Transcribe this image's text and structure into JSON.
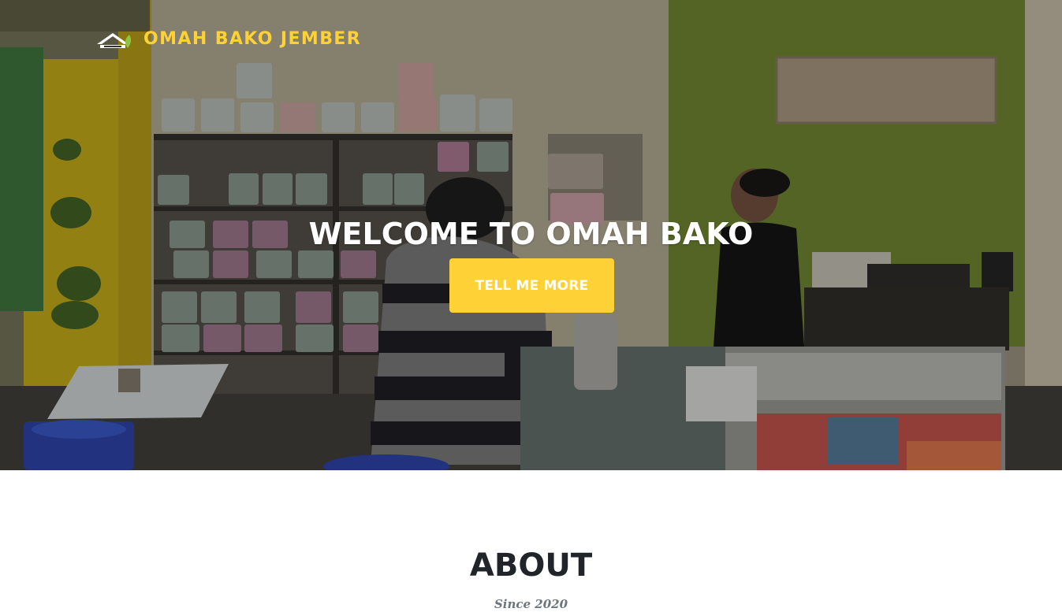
{
  "navbar": {
    "brand_name": "OMAH BAKO JEMBER",
    "logo_icon": "house-leaf-logo-icon"
  },
  "hero": {
    "title": "WELCOME TO OMAH BAKO",
    "button_label": "TELL ME MORE",
    "background": "photo-tobacco-shop-interior"
  },
  "about": {
    "heading": "ABOUT",
    "subheading": "Since 2020"
  },
  "colors": {
    "accent": "#fed136",
    "hero_text": "#ffffff",
    "heading_text": "#212529",
    "muted_text": "#6c757d"
  }
}
